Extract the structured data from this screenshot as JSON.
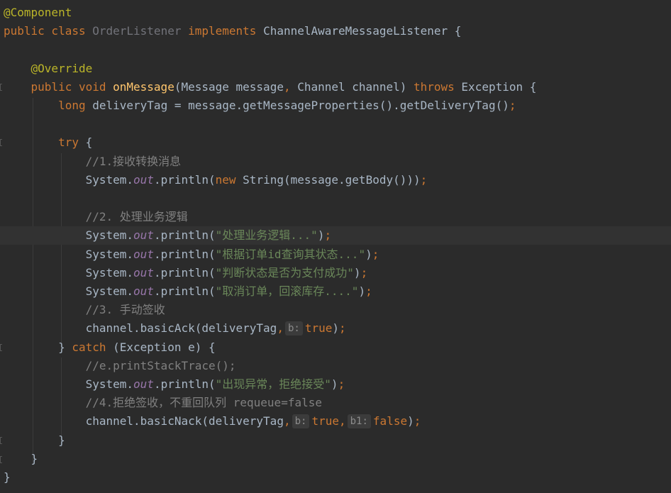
{
  "editor": {
    "lines": [
      {
        "tokens": [
          {
            "t": "@Component",
            "c": "ann"
          }
        ]
      },
      {
        "tokens": [
          {
            "t": "public class ",
            "c": "kw"
          },
          {
            "t": "OrderListener ",
            "c": "cls-unused"
          },
          {
            "t": "implements ",
            "c": "kw"
          },
          {
            "t": "ChannelAwareMessageListener {",
            "c": "cls"
          }
        ]
      },
      {
        "tokens": []
      },
      {
        "tokens": [
          {
            "t": "    "
          },
          {
            "t": "@Override",
            "c": "ann"
          }
        ]
      },
      {
        "tokens": [
          {
            "t": "    "
          },
          {
            "t": "public void ",
            "c": "kw"
          },
          {
            "t": "onMessage",
            "c": "fn"
          },
          {
            "t": "(Message message"
          },
          {
            "t": ", ",
            "c": "kw"
          },
          {
            "t": "Channel channel) "
          },
          {
            "t": "throws ",
            "c": "kw"
          },
          {
            "t": "Exception {"
          }
        ]
      },
      {
        "tokens": [
          {
            "t": "        "
          },
          {
            "t": "long ",
            "c": "kw"
          },
          {
            "t": "deliveryTag = message.getMessageProperties().getDeliveryTag()"
          },
          {
            "t": ";",
            "c": "kw"
          }
        ]
      },
      {
        "tokens": []
      },
      {
        "tokens": [
          {
            "t": "        "
          },
          {
            "t": "try ",
            "c": "kw"
          },
          {
            "t": "{"
          }
        ]
      },
      {
        "tokens": [
          {
            "t": "            "
          },
          {
            "t": "//1.接收转换消息",
            "c": "cmt"
          }
        ]
      },
      {
        "tokens": [
          {
            "t": "            System."
          },
          {
            "t": "out",
            "c": "field"
          },
          {
            "t": ".println("
          },
          {
            "t": "new ",
            "c": "kw"
          },
          {
            "t": "String(message.getBody()))"
          },
          {
            "t": ";",
            "c": "kw"
          }
        ]
      },
      {
        "tokens": []
      },
      {
        "tokens": [
          {
            "t": "            "
          },
          {
            "t": "//2. 处理业务逻辑",
            "c": "cmt"
          }
        ]
      },
      {
        "current": true,
        "tokens": [
          {
            "t": "            System."
          },
          {
            "t": "out",
            "c": "field"
          },
          {
            "t": ".println("
          },
          {
            "t": "\"处理业务逻辑...\"",
            "c": "str"
          },
          {
            "t": ")"
          },
          {
            "t": ";",
            "c": "kw"
          }
        ]
      },
      {
        "tokens": [
          {
            "t": "            System."
          },
          {
            "t": "out",
            "c": "field"
          },
          {
            "t": ".println("
          },
          {
            "t": "\"根据订单id查询其状态...\"",
            "c": "str"
          },
          {
            "t": ")"
          },
          {
            "t": ";",
            "c": "kw"
          }
        ]
      },
      {
        "tokens": [
          {
            "t": "            System."
          },
          {
            "t": "out",
            "c": "field"
          },
          {
            "t": ".println("
          },
          {
            "t": "\"判断状态是否为支付成功\"",
            "c": "str"
          },
          {
            "t": ")"
          },
          {
            "t": ";",
            "c": "kw"
          }
        ]
      },
      {
        "tokens": [
          {
            "t": "            System."
          },
          {
            "t": "out",
            "c": "field"
          },
          {
            "t": ".println("
          },
          {
            "t": "\"取消订单，回滚库存....\"",
            "c": "str"
          },
          {
            "t": ")"
          },
          {
            "t": ";",
            "c": "kw"
          }
        ]
      },
      {
        "tokens": [
          {
            "t": "            "
          },
          {
            "t": "//3. 手动签收",
            "c": "cmt"
          }
        ]
      },
      {
        "tokens": [
          {
            "t": "            channel.basicAck(deliveryTag"
          },
          {
            "t": ",",
            "c": "kw"
          },
          {
            "t": "b:",
            "c": "hint"
          },
          {
            "t": "true",
            "c": "kw"
          },
          {
            "t": ")"
          },
          {
            "t": ";",
            "c": "kw"
          }
        ]
      },
      {
        "tokens": [
          {
            "t": "        } "
          },
          {
            "t": "catch ",
            "c": "kw"
          },
          {
            "t": "(Exception e) {"
          }
        ]
      },
      {
        "tokens": [
          {
            "t": "            "
          },
          {
            "t": "//e.printStackTrace();",
            "c": "cmt"
          }
        ]
      },
      {
        "tokens": [
          {
            "t": "            System."
          },
          {
            "t": "out",
            "c": "field"
          },
          {
            "t": ".println("
          },
          {
            "t": "\"出现异常，拒绝接受\"",
            "c": "str"
          },
          {
            "t": ")"
          },
          {
            "t": ";",
            "c": "kw"
          }
        ]
      },
      {
        "tokens": [
          {
            "t": "            "
          },
          {
            "t": "//4.拒绝签收，不重回队列 requeue=false",
            "c": "cmt"
          }
        ]
      },
      {
        "tokens": [
          {
            "t": "            channel.basicNack(deliveryTag"
          },
          {
            "t": ",",
            "c": "kw"
          },
          {
            "t": "b:",
            "c": "hint"
          },
          {
            "t": "true",
            "c": "kw"
          },
          {
            "t": ",",
            "c": "kw"
          },
          {
            "t": "b1:",
            "c": "hint"
          },
          {
            "t": "false",
            "c": "kw"
          },
          {
            "t": ")"
          },
          {
            "t": ";",
            "c": "kw"
          }
        ]
      },
      {
        "tokens": [
          {
            "t": "        }"
          }
        ]
      },
      {
        "tokens": [
          {
            "t": "    }"
          }
        ]
      },
      {
        "tokens": [
          {
            "t": "}"
          }
        ]
      }
    ]
  },
  "colors": {
    "background": "#2b2b2b",
    "current_line": "#323232",
    "keyword": "#cc7832",
    "annotation": "#bbb529",
    "method": "#ffc66d",
    "string": "#6a8759",
    "comment": "#808080",
    "static_field": "#9876aa",
    "default_text": "#a9b7c6"
  }
}
